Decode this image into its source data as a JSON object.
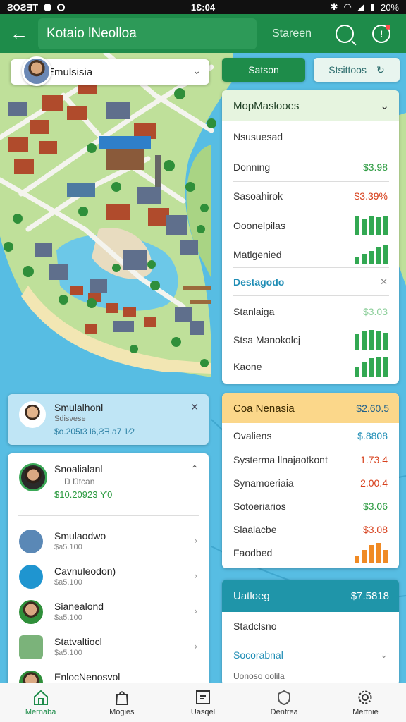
{
  "status_bar": {
    "carrier": "ƧOƧƎT",
    "time": "1Ɛ:04",
    "battery": "20%"
  },
  "app_bar": {
    "title": "Kotaio lNeolloa",
    "action_label": "Stareen"
  },
  "search": {
    "value": "Emulsisia"
  },
  "buttons": {
    "primary_label": "Satson",
    "secondary_label": "Stsittoos"
  },
  "map_panel": {
    "header": "MopMaslooes",
    "rows": [
      {
        "label": "Nsusuesad",
        "value": ""
      },
      {
        "label": "Donning",
        "value": "$3.98",
        "color": "green"
      },
      {
        "label": "Sasoahirok",
        "value": "$3.39%",
        "color": "red"
      },
      {
        "label": "Ooonelpilas",
        "value": "",
        "chart": [
          28,
          24,
          28,
          26,
          28
        ]
      },
      {
        "label": "Matlgenied",
        "value": "",
        "chart": [
          10,
          14,
          18,
          22,
          26
        ]
      }
    ],
    "section_title": "Destagodo",
    "section_rows": [
      {
        "label": "Stanlaiga",
        "value": "$3.03",
        "color": "lightgreen"
      },
      {
        "label": "Stsa Manokolcj",
        "value": "",
        "chart": [
          24,
          28,
          30,
          28,
          26
        ]
      },
      {
        "label": "Kaone",
        "value": "",
        "chart": [
          14,
          20,
          26,
          28,
          28
        ]
      }
    ]
  },
  "pricing_panel": {
    "header": "Coa Nenasia",
    "header_value": "$2.60.5",
    "rows": [
      {
        "label": "Ovaliens",
        "value": "$.8808",
        "color": "blue"
      },
      {
        "label": "Systerma llnajaotkont",
        "value": "1.73.4",
        "color": "red"
      },
      {
        "label": "Synamoeriaia",
        "value": "2.00.4",
        "color": "red"
      },
      {
        "label": "Sotoeriarios",
        "value": "$3.06",
        "color": "green"
      },
      {
        "label": "Slaalacbe",
        "value": "$3.08",
        "color": "red"
      },
      {
        "label": "Faodbed",
        "value": "",
        "chart": [
          8,
          14,
          20,
          22,
          14
        ]
      }
    ]
  },
  "teal_panel": {
    "header": "Uatloeg",
    "header_value": "$7.5818",
    "rows": [
      {
        "label": "Stadclsno"
      },
      {
        "label": "Socorabnal"
      },
      {
        "label": "Uonoso oolila"
      }
    ]
  },
  "notification": {
    "title": "Smulalhonl",
    "subtitle": "Sdisvese",
    "detail": "$o.205t3 Ɩ6,ƧƎ.a7 1⁄2"
  },
  "profile": {
    "name": "Snoalialanl",
    "handle": "Ŋ Ŋtcan",
    "amount": "$10.20923 Ƴ0"
  },
  "list_items": [
    {
      "title": "Smulaodwo",
      "sub": "$a5.100",
      "icon": "house-icon"
    },
    {
      "title": "Cavnuleodon)",
      "sub": "$a5.100",
      "icon": "message-icon"
    },
    {
      "title": "Sianealond",
      "sub": "$a5.100",
      "icon": "person-icon"
    },
    {
      "title": "Statvaltiocl",
      "sub": "$a5.100",
      "icon": "building-icon"
    },
    {
      "title": "EnlocNenosvol",
      "sub": "",
      "icon": "person-icon"
    }
  ],
  "bottom_nav": [
    {
      "label": "Mernaba",
      "icon": "home-icon"
    },
    {
      "label": "Mogies",
      "icon": "bag-icon"
    },
    {
      "label": "Uasqel",
      "icon": "square-icon"
    },
    {
      "label": "Denfrea",
      "icon": "shield-icon"
    },
    {
      "label": "Mertnie",
      "icon": "gear-icon"
    }
  ],
  "colors": {
    "primary": "#1e8c4a",
    "accent_orange": "#fbd78a",
    "accent_teal": "#1f95a9",
    "water": "#5cc3e6",
    "land": "#b9dc8f"
  }
}
